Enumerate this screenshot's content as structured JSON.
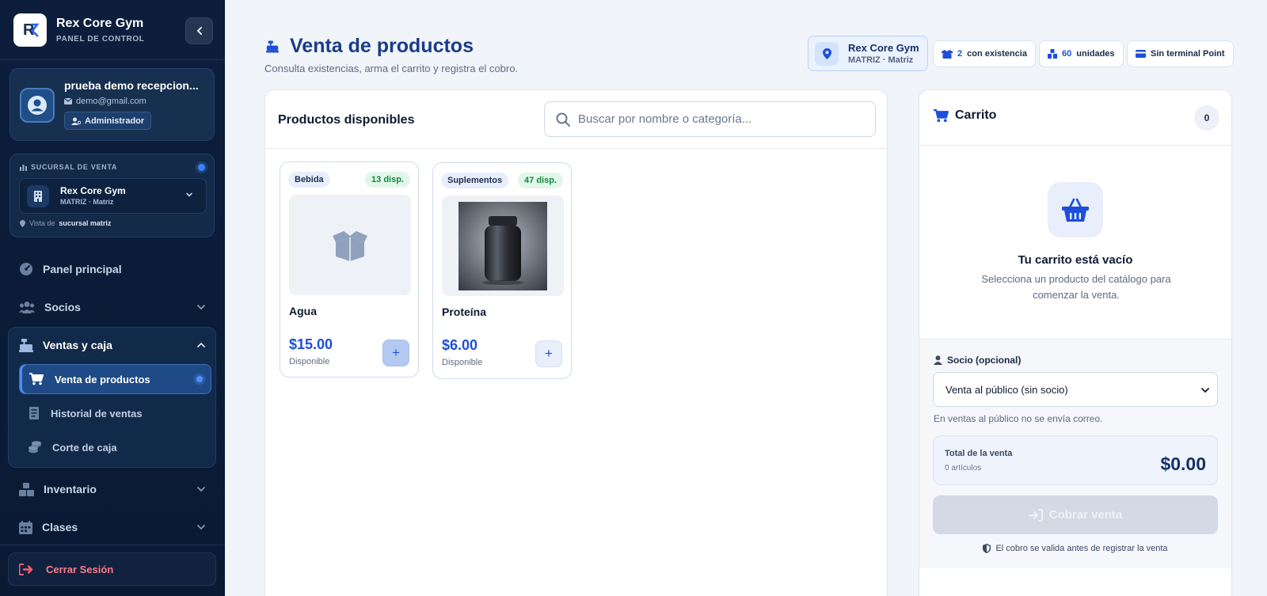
{
  "brand": {
    "title": "Rex Core Gym",
    "subtitle": "PANEL DE CONTROL"
  },
  "user": {
    "name": "prueba demo recepcion...",
    "email": "demo@gmail.com",
    "role": "Administrador"
  },
  "branch": {
    "label": "SUCURSAL DE VENTA",
    "name": "Rex Core Gym",
    "meta": "MATRIZ · Matriz",
    "foot_prefix": "Vista de",
    "foot_value": "sucursal matriz"
  },
  "nav": {
    "panel": "Panel principal",
    "socios": "Socios",
    "ventas": "Ventas y caja",
    "sub": [
      "Venta de productos",
      "Historial de ventas",
      "Corte de caja"
    ],
    "inventario": "Inventario",
    "clases": "Clases",
    "logout": "Cerrar Sesión"
  },
  "header": {
    "title": "Venta de productos",
    "subtitle": "Consulta existencias, arma el carrito y registra el cobro.",
    "location": {
      "name": "Rex Core Gym",
      "meta": "MATRIZ · Matriz"
    },
    "stock_count": "2",
    "stock_label": "con existencia",
    "units_count": "60",
    "units_label": "unidades",
    "terminal": "Sin terminal Point"
  },
  "products_panel": {
    "title": "Productos disponibles",
    "search_placeholder": "Buscar por nombre o categoría...",
    "items": [
      {
        "category": "Bebida",
        "stock": "13 disp.",
        "name": "Agua",
        "price": "$15.00",
        "status": "Disponible",
        "image": "box-icon"
      },
      {
        "category": "Suplementos",
        "stock": "47 disp.",
        "name": "Proteína",
        "price": "$6.00",
        "status": "Disponible",
        "image": "protein-jar-photo"
      }
    ]
  },
  "cart": {
    "title": "Carrito",
    "count": "0",
    "empty_title": "Tu carrito está vacío",
    "empty_sub": "Selecciona un producto del catálogo para comenzar la venta.",
    "socio_label": "Socio (opcional)",
    "socio_value": "Venta al público (sin socio)",
    "socio_note": "En ventas al público no se envía correo.",
    "total_label": "Total de la venta",
    "total_items": "0 artículos",
    "total_amount": "$0.00",
    "pay_label": "Cobrar venta",
    "pay_note": "El cobro se valida antes de registrar la venta"
  },
  "colors": {
    "sidebar_bg": "#0c1e3c",
    "accent": "#1d4fd8",
    "title": "#1a3c8a",
    "stock_green": "#138a3e",
    "logout_red": "#ff7b8a"
  }
}
